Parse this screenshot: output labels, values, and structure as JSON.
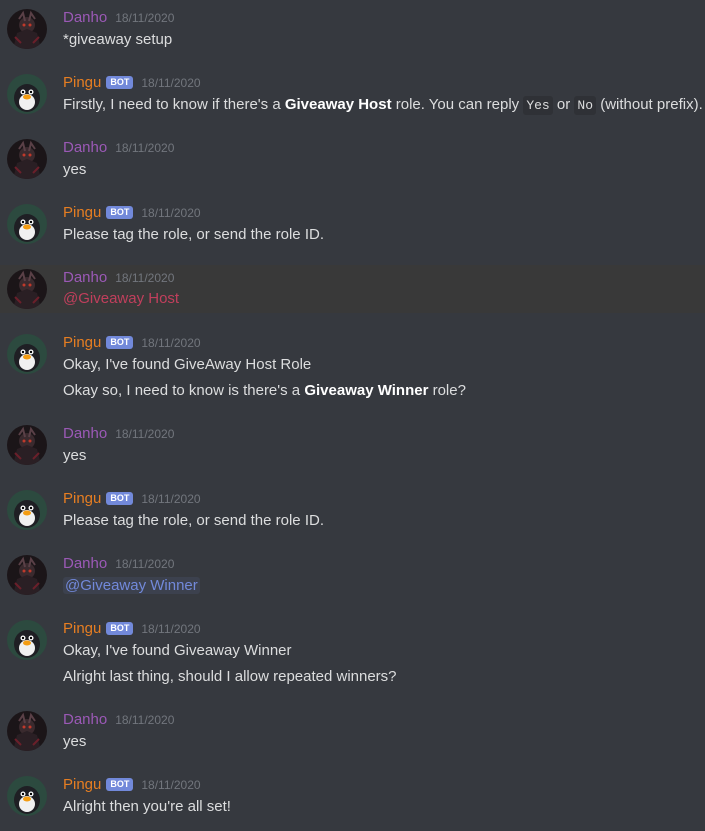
{
  "users": {
    "danho": {
      "name": "Danho",
      "color": "#9b59b6"
    },
    "pingu": {
      "name": "Pingu",
      "color": "#e67e22",
      "bot_tag": "BOT"
    }
  },
  "messages": [
    {
      "author": "Danho",
      "timestamp": "18/11/2020",
      "lines": [
        "*giveaway setup"
      ]
    },
    {
      "author": "Pingu",
      "bot_tag": "BOT",
      "timestamp": "18/11/2020",
      "line_parts": {
        "a": "Firstly, I need to know if there's a ",
        "b": "Giveaway Host",
        "c": " role. You can reply ",
        "code1": "Yes",
        "d": " or ",
        "code2": "No",
        "e": " (without prefix)."
      }
    },
    {
      "author": "Danho",
      "timestamp": "18/11/2020",
      "lines": [
        "yes"
      ]
    },
    {
      "author": "Pingu",
      "bot_tag": "BOT",
      "timestamp": "18/11/2020",
      "lines": [
        "Please tag the role, or send the role ID."
      ]
    },
    {
      "author": "Danho",
      "timestamp": "18/11/2020",
      "mention": "@Giveaway Host"
    },
    {
      "author": "Pingu",
      "bot_tag": "BOT",
      "timestamp": "18/11/2020",
      "lines": [
        "Okay, I've found GiveAway Host Role"
      ],
      "line2_parts": {
        "a": "Okay so, I need to know is there's a ",
        "b": "Giveaway Winner",
        "c": " role?"
      }
    },
    {
      "author": "Danho",
      "timestamp": "18/11/2020",
      "lines": [
        "yes"
      ]
    },
    {
      "author": "Pingu",
      "bot_tag": "BOT",
      "timestamp": "18/11/2020",
      "lines": [
        "Please tag the role, or send the role ID."
      ]
    },
    {
      "author": "Danho",
      "timestamp": "18/11/2020",
      "mention": "@Giveaway Winner"
    },
    {
      "author": "Pingu",
      "bot_tag": "BOT",
      "timestamp": "18/11/2020",
      "lines": [
        "Okay, I've found Giveaway Winner",
        "Alright last thing, should I allow repeated winners?"
      ]
    },
    {
      "author": "Danho",
      "timestamp": "18/11/2020",
      "lines": [
        "yes"
      ]
    },
    {
      "author": "Pingu",
      "bot_tag": "BOT",
      "timestamp": "18/11/2020",
      "lines": [
        "Alright then you're all set!"
      ]
    }
  ],
  "colors": {
    "background": "#36393f",
    "highlight_row": "#393939",
    "text": "#dcddde",
    "timestamp": "#72767d",
    "bot_tag_bg": "#7289da",
    "mention_blue": "#7289da",
    "mention_pink": "#c13f5c"
  },
  "icons": {
    "danho_avatar": "dark-character-avatar-icon",
    "pingu_avatar": "penguin-avatar-icon"
  }
}
